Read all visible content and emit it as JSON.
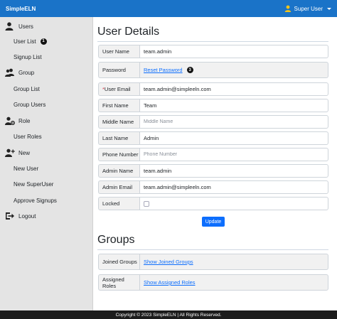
{
  "header": {
    "brand": "SimpleELN",
    "user_name": "Super User"
  },
  "sidebar": {
    "users": "Users",
    "user_list": "User List",
    "user_list_badge": "1",
    "signup_list": "Signup List",
    "group": "Group",
    "group_list": "Group List",
    "group_users": "Group Users",
    "role": "Role",
    "user_roles": "User Roles",
    "new": "New",
    "new_user": "New User",
    "new_superuser": "New SuperUser",
    "approve_signups": "Approve Signups",
    "logout": "Logout"
  },
  "details": {
    "heading": "User Details",
    "username_label": "User Name",
    "username_value": "team.admin",
    "password_label": "Password",
    "password_link": "Reset Password",
    "password_badge": "3",
    "email_required": "*",
    "email_label": "User Email",
    "email_value": "team.admin@simpleeln.com",
    "first_name_label": "First Name",
    "first_name_value": "Team",
    "middle_name_label": "Middle Name",
    "middle_name_placeholder": "Middle Name",
    "last_name_label": "Last Name",
    "last_name_value": "Admin",
    "phone_label": "Phone Number",
    "phone_placeholder": "Phone Number",
    "admin_name_label": "Admin Name",
    "admin_name_value": "team.admin",
    "admin_email_label": "Admin Email",
    "admin_email_value": "team.admin@simpleeln.com",
    "locked_label": "Locked",
    "locked_checked": false,
    "update_button": "Update"
  },
  "groups": {
    "heading": "Groups",
    "joined_label": "Joined Groups",
    "joined_link": "Show Joined Groups",
    "roles_label": "Assigned Roles",
    "roles_link": "Show Assigned Roles"
  },
  "footer": {
    "text": "Copyright © 2023 SimpleELN | All Rights Reserved."
  }
}
